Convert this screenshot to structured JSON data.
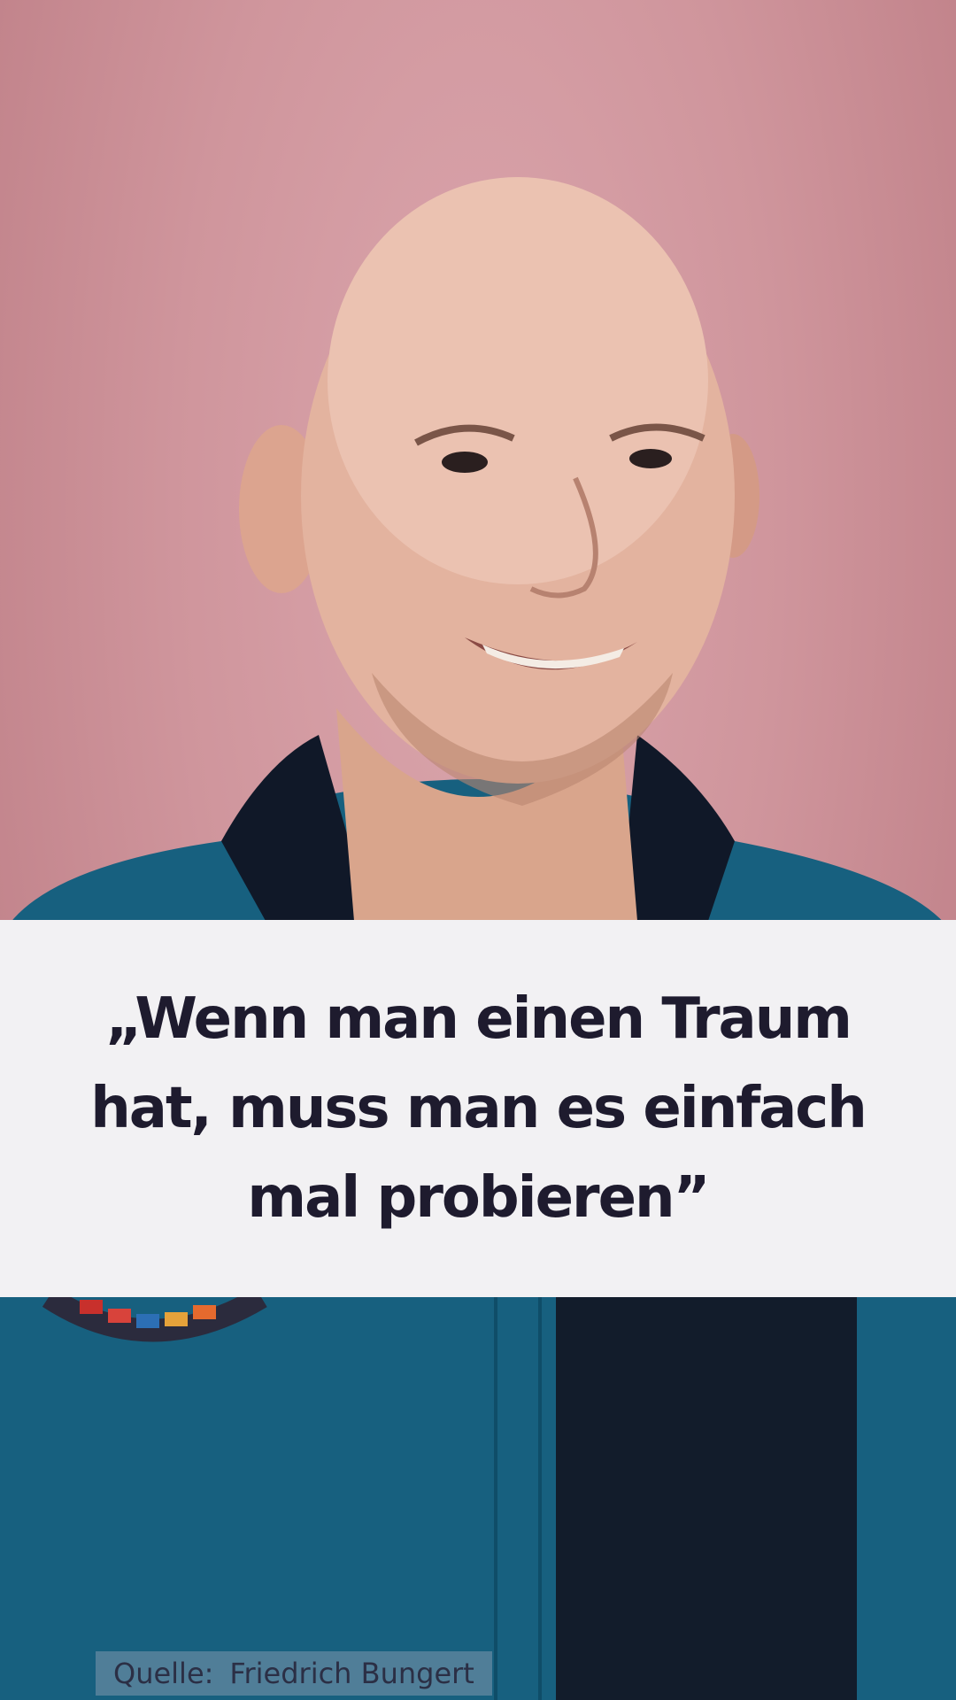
{
  "quote": {
    "text": "„Wenn man einen Traum hat, muss man es einfach mal probieren”"
  },
  "source": {
    "label": "Quelle:",
    "name": "Friedrich Bungert"
  },
  "colors": {
    "background": "#d39ba2",
    "panel": "#f2f1f3",
    "text": "#1e1b2e",
    "jacket": "#17607f"
  }
}
